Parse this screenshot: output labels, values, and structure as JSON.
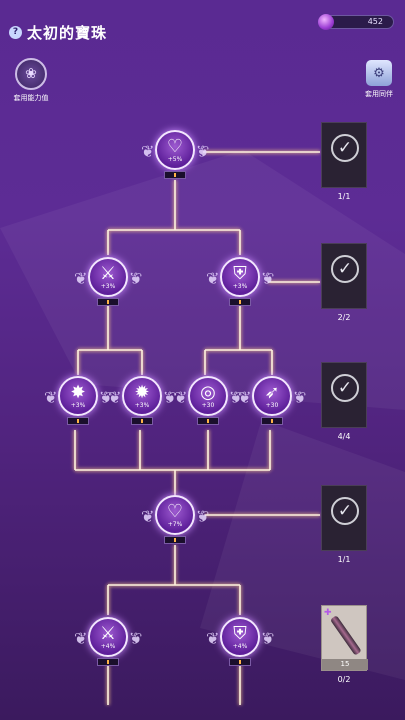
{
  "header": {
    "title": "太初的寶珠",
    "help_glyph": "?",
    "currency_value": "452"
  },
  "side_buttons": {
    "ability_label": "套用能力值",
    "partner_label": "套用同伴"
  },
  "nodes": [
    {
      "id": "n1",
      "symbol": "♡",
      "icon": "heart-icon",
      "value": "+5%"
    },
    {
      "id": "n2",
      "symbol": "⚔",
      "icon": "sword-icon",
      "value": "+3%"
    },
    {
      "id": "n3",
      "symbol": "⛨",
      "icon": "shield-icon",
      "value": "+3%"
    },
    {
      "id": "n4",
      "symbol": "✸",
      "icon": "burst-icon",
      "value": "+3%"
    },
    {
      "id": "n5",
      "symbol": "✹",
      "icon": "burst-plus-icon",
      "value": "+3%"
    },
    {
      "id": "n6",
      "symbol": "◎",
      "icon": "target-icon",
      "value": "+30"
    },
    {
      "id": "n7",
      "symbol": "➶",
      "icon": "runner-icon",
      "value": "+30"
    },
    {
      "id": "n8",
      "symbol": "♡",
      "icon": "heart-icon",
      "value": "+7%"
    },
    {
      "id": "n9",
      "symbol": "⚔",
      "icon": "sword-icon",
      "value": "+4%"
    },
    {
      "id": "n10",
      "symbol": "⛨",
      "icon": "shield-icon",
      "value": "+4%"
    }
  ],
  "rewards": [
    {
      "count": "1/1",
      "type": "claimed"
    },
    {
      "count": "2/2",
      "type": "claimed"
    },
    {
      "count": "4/4",
      "type": "claimed"
    },
    {
      "count": "1/1",
      "type": "claimed"
    },
    {
      "count": "0/2",
      "type": "item",
      "qty": "15"
    }
  ],
  "colors": {
    "line_glow": "#ffc98a",
    "accent": "#9d5ad0"
  }
}
